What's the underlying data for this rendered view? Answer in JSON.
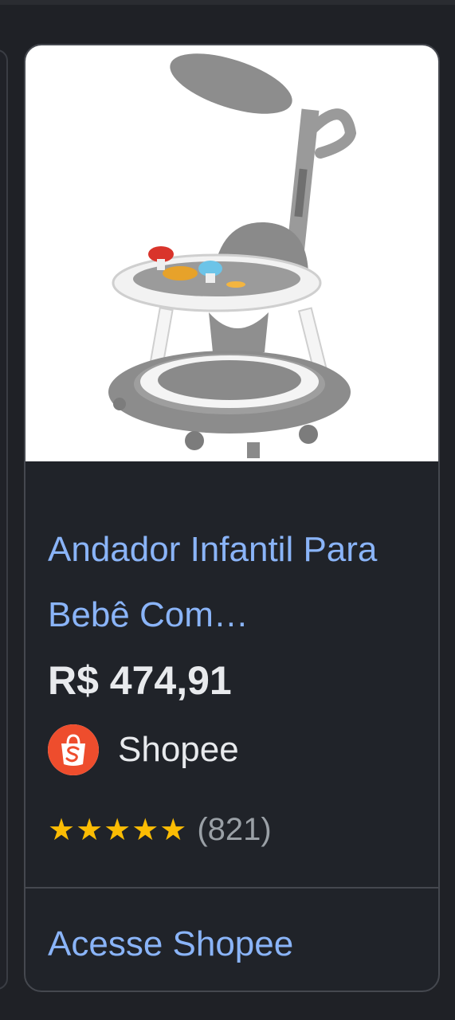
{
  "product": {
    "title": "Andador Infantil Para Bebê Com…",
    "price": "R$ 474,91",
    "seller": "Shopee",
    "stars": "★★★★★",
    "rating": 5,
    "review_count": "(821)",
    "cta_label": "Acesse Shopee"
  },
  "colors": {
    "link": "#8ab4f8",
    "star": "#fbbc04",
    "shopee": "#ee4d2d"
  }
}
